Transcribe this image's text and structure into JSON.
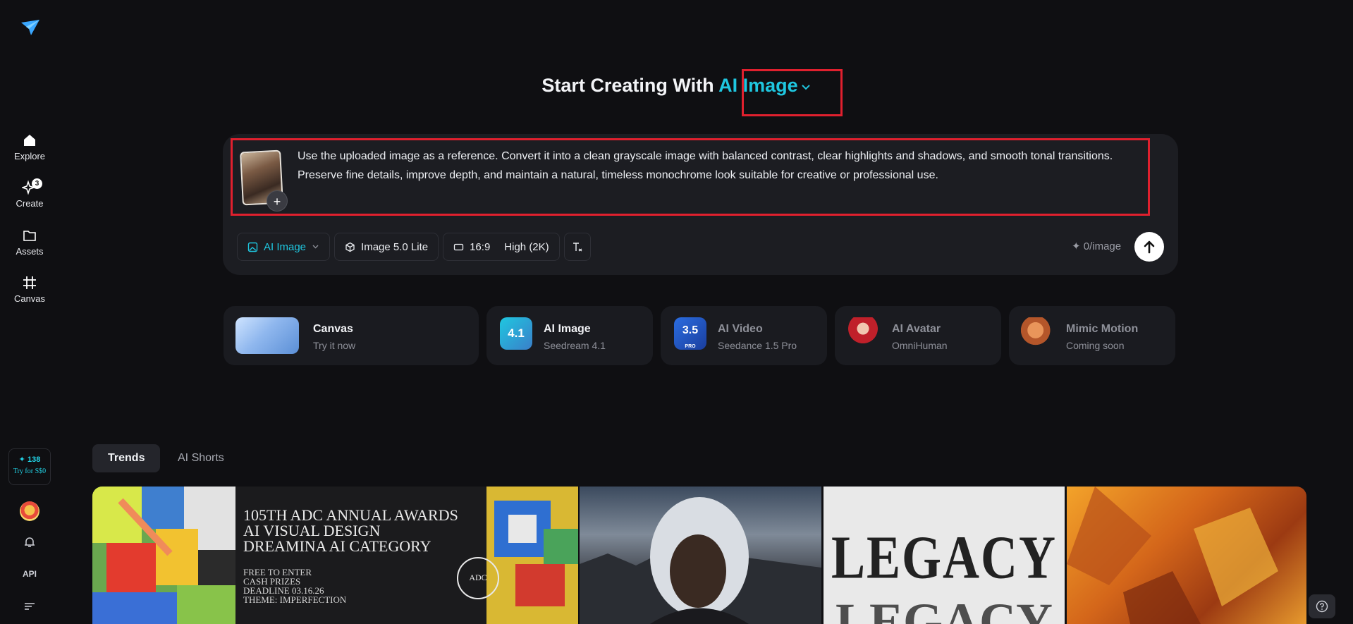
{
  "sidebar": {
    "logo": "paper-plane-logo",
    "items": [
      {
        "label": "Explore",
        "icon": "home-icon"
      },
      {
        "label": "Create",
        "icon": "sparkle-edit-icon",
        "badge": "3"
      },
      {
        "label": "Assets",
        "icon": "folder-icon"
      },
      {
        "label": "Canvas",
        "icon": "canvas-frame-icon"
      }
    ],
    "credits": "138",
    "try_label": "Try for S$0",
    "api_label": "API"
  },
  "heading": {
    "prefix": "Start Creating With",
    "mode": "AI Image"
  },
  "prompt": {
    "text": "Use the uploaded image as a reference. Convert it into a clean grayscale image with balanced contrast, clear highlights and shadows, and smooth tonal transitions. Preserve fine details, improve depth, and maintain a natural, timeless monochrome look suitable for creative or professional use.",
    "add_label": "+"
  },
  "toolbar": {
    "mode_label": "AI Image",
    "model_label": "Image 5.0 Lite",
    "ratio_label": "16:9",
    "quality_label": "High (2K)",
    "cost_label": "0/image"
  },
  "cards": [
    {
      "title": "Canvas",
      "subtitle": "Try it now"
    },
    {
      "title": "AI Image",
      "subtitle": "Seedream 4.1",
      "version": "4.1"
    },
    {
      "title": "AI Video",
      "subtitle": "Seedance 1.5 Pro",
      "version": "3.5",
      "tag": "PRO"
    },
    {
      "title": "AI Avatar",
      "subtitle": "OmniHuman"
    },
    {
      "title": "Mimic Motion",
      "subtitle": "Coming soon"
    }
  ],
  "tabs": [
    {
      "label": "Trends",
      "active": true
    },
    {
      "label": "AI Shorts",
      "active": false
    }
  ],
  "gallery": {
    "poster_lines": [
      "105TH ADC ANNUAL AWARDS",
      "AI VISUAL DESIGN",
      "DREAMINA AI CATEGORY"
    ],
    "poster_details": [
      "FREE TO ENTER",
      "CASH PRIZES",
      "DEADLINE 03.16.26",
      "THEME: IMPERFECTION"
    ],
    "poster_badge": "ADC",
    "legacy_word": "LEGACY"
  },
  "colors": {
    "accent": "#1fc7e0",
    "highlight": "#e0202e",
    "background": "#0f0f12",
    "panel": "#1c1d22"
  }
}
